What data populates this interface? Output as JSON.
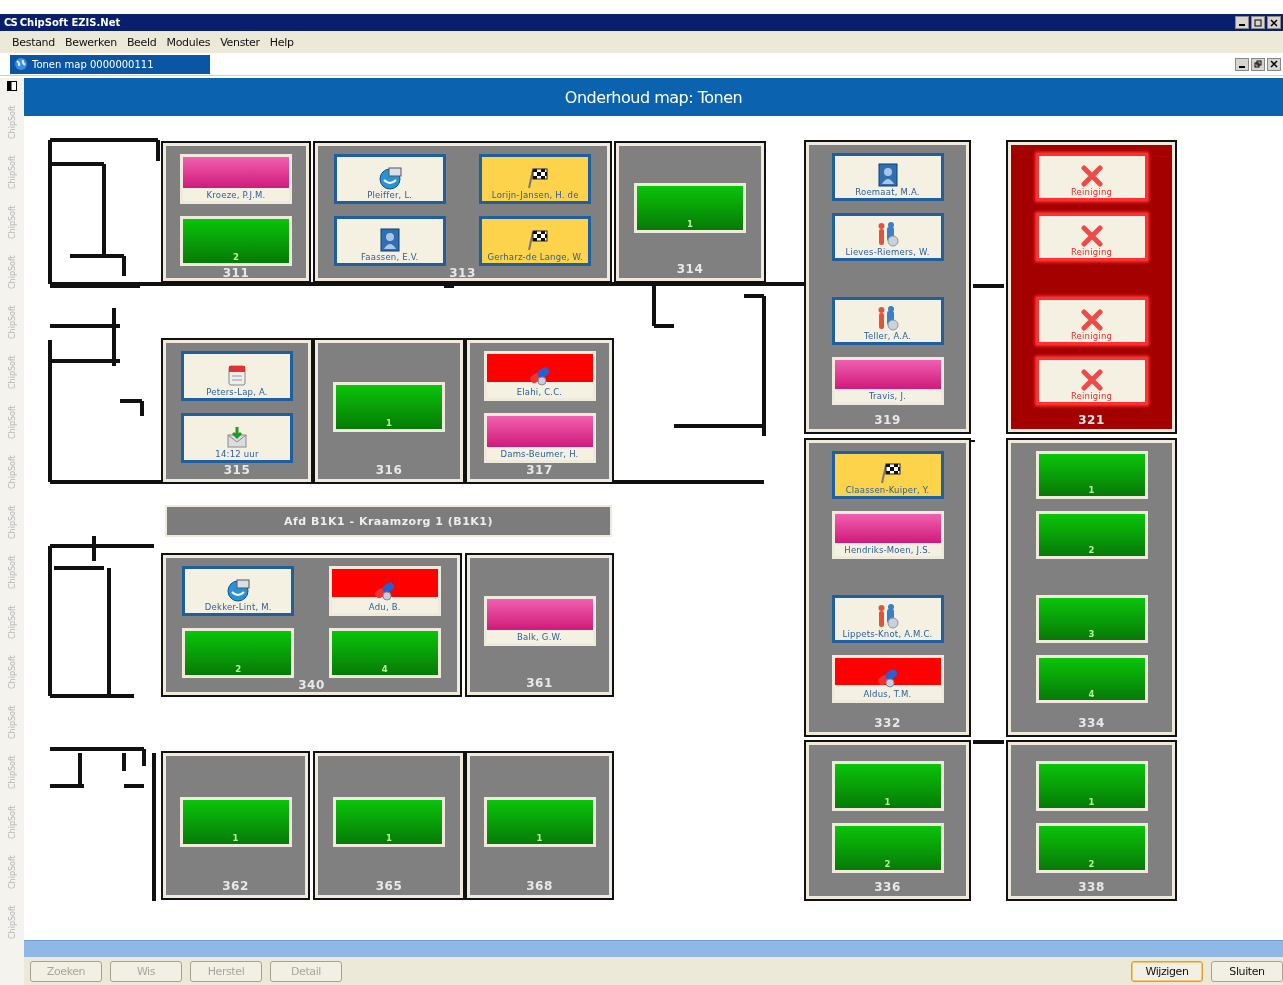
{
  "window": {
    "logo": "CS",
    "title": "ChipSoft EZIS.Net"
  },
  "menu": [
    "Bestand",
    "Bewerken",
    "Beeld",
    "Modules",
    "Venster",
    "Help"
  ],
  "document_tab": {
    "label": "Tonen map 0000000111",
    "selected": true
  },
  "side_strip": [
    "ChipSoft",
    "ChipSoft",
    "ChipSoft",
    "ChipSoft",
    "ChipSoft",
    "ChipSoft",
    "ChipSoft",
    "ChipSoft",
    "ChipSoft",
    "ChipSoft",
    "ChipSoft",
    "ChipSoft",
    "ChipSoft",
    "ChipSoft",
    "ChipSoft",
    "ChipSoft",
    "ChipSoft"
  ],
  "header": "Onderhoud map: Tonen",
  "department": "Afd B1K1 - Kraamzorg 1 (B1K1)",
  "rooms": [
    {
      "number": "311",
      "alert": false,
      "beds": [
        {
          "kind": "planned",
          "label": "Kroeze, P.J.M."
        },
        {
          "kind": "free",
          "label": "2"
        }
      ]
    },
    {
      "number": "313",
      "alert": false,
      "beds": [
        {
          "kind": "contact",
          "label": "Pleiffer, L."
        },
        {
          "kind": "discharge",
          "label": "Lorijn-Jansen, H. de"
        },
        {
          "kind": "portrait",
          "label": "Faassen, E.V."
        },
        {
          "kind": "discharge",
          "label": "Gerharz-de Lange, W."
        }
      ]
    },
    {
      "number": "314",
      "alert": false,
      "beds": [
        {
          "kind": "free",
          "label": "1"
        }
      ]
    },
    {
      "number": "315",
      "alert": false,
      "beds": [
        {
          "kind": "calendar",
          "label": "Peters-Lap, A."
        },
        {
          "kind": "mail",
          "label": "14:12 uur"
        }
      ]
    },
    {
      "number": "316",
      "alert": false,
      "beds": [
        {
          "kind": "free",
          "label": "1"
        }
      ]
    },
    {
      "number": "317",
      "alert": false,
      "beds": [
        {
          "kind": "medication",
          "label": "Elahi, C.C."
        },
        {
          "kind": "planned",
          "label": "Dams-Beumer, H."
        }
      ]
    },
    {
      "number": "340",
      "alert": false,
      "beds": [
        {
          "kind": "contact",
          "label": "Dekker-Lint, M."
        },
        {
          "kind": "medication",
          "label": "Adu, B."
        },
        {
          "kind": "free",
          "label": "2"
        },
        {
          "kind": "free",
          "label": "4"
        }
      ]
    },
    {
      "number": "361",
      "alert": false,
      "beds": [
        {
          "kind": "planned",
          "label": "Balk, G.W."
        }
      ]
    },
    {
      "number": "362",
      "alert": false,
      "beds": [
        {
          "kind": "free",
          "label": "1"
        }
      ]
    },
    {
      "number": "365",
      "alert": false,
      "beds": [
        {
          "kind": "free",
          "label": "1"
        }
      ]
    },
    {
      "number": "368",
      "alert": false,
      "beds": [
        {
          "kind": "free",
          "label": "1"
        }
      ]
    },
    {
      "number": "319",
      "alert": false,
      "beds": [
        {
          "kind": "portrait",
          "label": "Roemaat, M.A."
        },
        {
          "kind": "care",
          "label": "Lieves-Riemers, W."
        },
        {
          "kind": "care",
          "label": "Teller, A.A."
        },
        {
          "kind": "planned",
          "label": "Travis, J."
        }
      ]
    },
    {
      "number": "321",
      "alert": true,
      "beds": [
        {
          "kind": "cleaning",
          "label": "Reiniging"
        },
        {
          "kind": "cleaning",
          "label": "Reiniging"
        },
        {
          "kind": "cleaning",
          "label": "Reiniging"
        },
        {
          "kind": "cleaning",
          "label": "Reiniging"
        }
      ]
    },
    {
      "number": "332",
      "alert": false,
      "beds": [
        {
          "kind": "discharge",
          "label": "Claassen-Kuiper, Y."
        },
        {
          "kind": "planned",
          "label": "Hendriks-Moen, J.S."
        },
        {
          "kind": "care",
          "label": "Lippets-Knot, A.M.C."
        },
        {
          "kind": "medication",
          "label": "Aldus, T.M."
        }
      ]
    },
    {
      "number": "334",
      "alert": false,
      "beds": [
        {
          "kind": "free",
          "label": "1"
        },
        {
          "kind": "free",
          "label": "2"
        },
        {
          "kind": "free",
          "label": "3"
        },
        {
          "kind": "free",
          "label": "4"
        }
      ]
    },
    {
      "number": "336",
      "alert": false,
      "beds": [
        {
          "kind": "free",
          "label": "1"
        },
        {
          "kind": "free",
          "label": "2"
        }
      ]
    },
    {
      "number": "338",
      "alert": false,
      "beds": [
        {
          "kind": "free",
          "label": "1"
        },
        {
          "kind": "free",
          "label": "2"
        }
      ]
    }
  ],
  "buttons": [
    {
      "label": "Zoeken",
      "disabled": true,
      "focused": false
    },
    {
      "label": "Wis",
      "disabled": true,
      "focused": false
    },
    {
      "label": "Herstel",
      "disabled": true,
      "focused": false
    },
    {
      "label": "Detail",
      "disabled": true,
      "focused": false
    },
    {
      "label": "Wijzigen",
      "disabled": false,
      "focused": true
    },
    {
      "label": "Sluiten",
      "disabled": false,
      "focused": false
    }
  ]
}
